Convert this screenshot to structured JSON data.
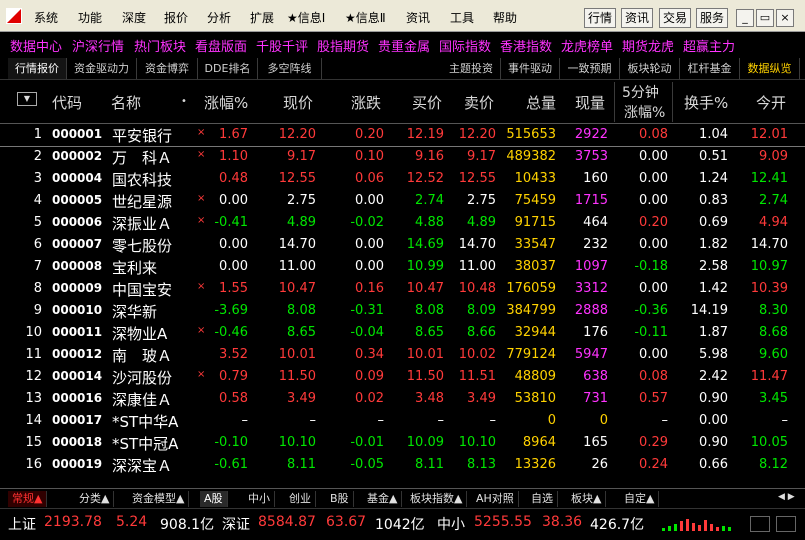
{
  "menu": [
    "系统",
    "功能",
    "深度",
    "报价",
    "分析",
    "扩展",
    "★信息Ⅰ",
    "★信息Ⅱ",
    "资讯",
    "工具",
    "帮助"
  ],
  "toolbar_buttons": [
    "行情",
    "资讯",
    "交易",
    "服务"
  ],
  "quicklinks": [
    "数据中心",
    "沪深行情",
    "热门板块",
    "看盘版面",
    "千股千评",
    "股指期货",
    "贵重金属",
    "国际指数",
    "香港指数",
    "龙虎榜单",
    "期货龙虎",
    "超赢主力"
  ],
  "tabs_left": [
    "行情报价",
    "资金驱动力",
    "资金博弈",
    "DDE排名",
    "多空阵线"
  ],
  "tabs_right": [
    "主题投资",
    "事件驱动",
    "一致预期",
    "板块轮动",
    "杠杆基金",
    "数据纵览"
  ],
  "columns": {
    "menu_toggle": "▼",
    "code": "代码",
    "name": "名称",
    "dot": "•",
    "pct_change": "涨幅%",
    "price": "现价",
    "change": "涨跌",
    "bid": "买价",
    "ask": "卖价",
    "volume": "总量",
    "cur_vol": "现量",
    "five_min_top": "5分钟",
    "five_min_bottom": "涨幅%",
    "turnover": "换手%",
    "open": "今开"
  },
  "rows": [
    {
      "i": "1",
      "code": "000001",
      "name": "平安银行",
      "mark": "×",
      "pct": "1.67",
      "price": "12.20",
      "chg": "0.20",
      "bid": "12.19",
      "ask": "12.20",
      "vol": "515653",
      "cur": "2922",
      "m5": "0.08",
      "turn": "1.04",
      "open": "12.01",
      "c": {
        "pct": "red",
        "price": "red",
        "chg": "red",
        "bid": "red",
        "ask": "red",
        "cur": "magenta",
        "m5": "red",
        "open": "red"
      }
    },
    {
      "i": "2",
      "code": "000002",
      "name": "万　科Ａ",
      "mark": "×",
      "pct": "1.10",
      "price": "9.17",
      "chg": "0.10",
      "bid": "9.16",
      "ask": "9.17",
      "vol": "489382",
      "cur": "3753",
      "m5": "0.00",
      "turn": "0.51",
      "open": "9.09",
      "c": {
        "pct": "red",
        "price": "red",
        "chg": "red",
        "bid": "red",
        "ask": "red",
        "cur": "magenta",
        "m5": "white",
        "open": "red"
      }
    },
    {
      "i": "3",
      "code": "000004",
      "name": "国农科技",
      "mark": "",
      "pct": "0.48",
      "price": "12.55",
      "chg": "0.06",
      "bid": "12.52",
      "ask": "12.55",
      "vol": "10433",
      "cur": "160",
      "m5": "0.00",
      "turn": "1.24",
      "open": "12.41",
      "c": {
        "pct": "red",
        "price": "red",
        "chg": "red",
        "bid": "red",
        "ask": "red",
        "cur": "white",
        "m5": "white",
        "open": "green"
      }
    },
    {
      "i": "4",
      "code": "000005",
      "name": "世纪星源",
      "mark": "×",
      "pct": "0.00",
      "price": "2.75",
      "chg": "0.00",
      "bid": "2.74",
      "ask": "2.75",
      "vol": "75459",
      "cur": "1715",
      "m5": "0.00",
      "turn": "0.83",
      "open": "2.74",
      "c": {
        "pct": "white",
        "price": "white",
        "chg": "white",
        "bid": "green",
        "ask": "white",
        "cur": "magenta",
        "m5": "white",
        "open": "green"
      }
    },
    {
      "i": "5",
      "code": "000006",
      "name": "深振业Ａ",
      "mark": "×",
      "pct": "-0.41",
      "price": "4.89",
      "chg": "-0.02",
      "bid": "4.88",
      "ask": "4.89",
      "vol": "91715",
      "cur": "464",
      "m5": "0.20",
      "turn": "0.69",
      "open": "4.94",
      "c": {
        "pct": "green",
        "price": "green",
        "chg": "green",
        "bid": "green",
        "ask": "green",
        "cur": "white",
        "m5": "red",
        "open": "red"
      }
    },
    {
      "i": "6",
      "code": "000007",
      "name": "零七股份",
      "mark": "",
      "pct": "0.00",
      "price": "14.70",
      "chg": "0.00",
      "bid": "14.69",
      "ask": "14.70",
      "vol": "33547",
      "cur": "232",
      "m5": "0.00",
      "turn": "1.82",
      "open": "14.70",
      "c": {
        "pct": "white",
        "price": "white",
        "chg": "white",
        "bid": "green",
        "ask": "white",
        "cur": "white",
        "m5": "white",
        "open": "white"
      }
    },
    {
      "i": "7",
      "code": "000008",
      "name": "宝利来",
      "mark": "",
      "pct": "0.00",
      "price": "11.00",
      "chg": "0.00",
      "bid": "10.99",
      "ask": "11.00",
      "vol": "38037",
      "cur": "1097",
      "m5": "-0.18",
      "turn": "2.58",
      "open": "10.97",
      "c": {
        "pct": "white",
        "price": "white",
        "chg": "white",
        "bid": "green",
        "ask": "white",
        "cur": "magenta",
        "m5": "green",
        "open": "green"
      }
    },
    {
      "i": "8",
      "code": "000009",
      "name": "中国宝安",
      "mark": "×",
      "pct": "1.55",
      "price": "10.47",
      "chg": "0.16",
      "bid": "10.47",
      "ask": "10.48",
      "vol": "176059",
      "cur": "3312",
      "m5": "0.00",
      "turn": "1.42",
      "open": "10.39",
      "c": {
        "pct": "red",
        "price": "red",
        "chg": "red",
        "bid": "red",
        "ask": "red",
        "cur": "magenta",
        "m5": "white",
        "open": "red"
      }
    },
    {
      "i": "9",
      "code": "000010",
      "name": "深华新",
      "mark": "",
      "pct": "-3.69",
      "price": "8.08",
      "chg": "-0.31",
      "bid": "8.08",
      "ask": "8.09",
      "vol": "384799",
      "cur": "2888",
      "m5": "-0.36",
      "turn": "14.19",
      "open": "8.30",
      "c": {
        "pct": "green",
        "price": "green",
        "chg": "green",
        "bid": "green",
        "ask": "green",
        "cur": "magenta",
        "m5": "green",
        "open": "green"
      }
    },
    {
      "i": "10",
      "code": "000011",
      "name": "深物业A",
      "mark": "×",
      "pct": "-0.46",
      "price": "8.65",
      "chg": "-0.04",
      "bid": "8.65",
      "ask": "8.66",
      "vol": "32944",
      "cur": "176",
      "m5": "-0.11",
      "turn": "1.87",
      "open": "8.68",
      "c": {
        "pct": "green",
        "price": "green",
        "chg": "green",
        "bid": "green",
        "ask": "green",
        "cur": "white",
        "m5": "green",
        "open": "green"
      }
    },
    {
      "i": "11",
      "code": "000012",
      "name": "南　玻Ａ",
      "mark": "",
      "pct": "3.52",
      "price": "10.01",
      "chg": "0.34",
      "bid": "10.01",
      "ask": "10.02",
      "vol": "779124",
      "cur": "5947",
      "m5": "0.00",
      "turn": "5.98",
      "open": "9.60",
      "c": {
        "pct": "red",
        "price": "red",
        "chg": "red",
        "bid": "red",
        "ask": "red",
        "cur": "magenta",
        "m5": "white",
        "open": "green"
      }
    },
    {
      "i": "12",
      "code": "000014",
      "name": "沙河股份",
      "mark": "×",
      "pct": "0.79",
      "price": "11.50",
      "chg": "0.09",
      "bid": "11.50",
      "ask": "11.51",
      "vol": "48809",
      "cur": "638",
      "m5": "0.08",
      "turn": "2.42",
      "open": "11.47",
      "c": {
        "pct": "red",
        "price": "red",
        "chg": "red",
        "bid": "red",
        "ask": "red",
        "cur": "magenta",
        "m5": "red",
        "open": "red"
      }
    },
    {
      "i": "13",
      "code": "000016",
      "name": "深康佳Ａ",
      "mark": "",
      "pct": "0.58",
      "price": "3.49",
      "chg": "0.02",
      "bid": "3.48",
      "ask": "3.49",
      "vol": "53810",
      "cur": "731",
      "m5": "0.57",
      "turn": "0.90",
      "open": "3.45",
      "c": {
        "pct": "red",
        "price": "red",
        "chg": "red",
        "bid": "red",
        "ask": "red",
        "cur": "magenta",
        "m5": "red",
        "open": "green"
      }
    },
    {
      "i": "14",
      "code": "000017",
      "name": "*ST中华A",
      "mark": "",
      "pct": "–",
      "price": "–",
      "chg": "–",
      "bid": "–",
      "ask": "–",
      "vol": "0",
      "cur": "0",
      "m5": "–",
      "turn": "0.00",
      "open": "–",
      "c": {
        "pct": "white",
        "price": "white",
        "chg": "white",
        "bid": "white",
        "ask": "white",
        "cur": "yellow",
        "m5": "white",
        "open": "white"
      }
    },
    {
      "i": "15",
      "code": "000018",
      "name": "*ST中冠A",
      "mark": "",
      "pct": "-0.10",
      "price": "10.10",
      "chg": "-0.01",
      "bid": "10.09",
      "ask": "10.10",
      "vol": "8964",
      "cur": "165",
      "m5": "0.29",
      "turn": "0.90",
      "open": "10.05",
      "c": {
        "pct": "green",
        "price": "green",
        "chg": "green",
        "bid": "green",
        "ask": "green",
        "cur": "white",
        "m5": "red",
        "open": "green"
      }
    },
    {
      "i": "16",
      "code": "000019",
      "name": "深深宝Ａ",
      "mark": "",
      "pct": "-0.61",
      "price": "8.11",
      "chg": "-0.05",
      "bid": "8.11",
      "ask": "8.13",
      "vol": "13326",
      "cur": "26",
      "m5": "0.24",
      "turn": "0.66",
      "open": "8.12",
      "c": {
        "pct": "green",
        "price": "green",
        "chg": "green",
        "bid": "green",
        "ask": "green",
        "cur": "white",
        "m5": "red",
        "open": "green"
      }
    }
  ],
  "bottom_tabs": [
    "常规▲",
    "分类▲",
    "资金模型▲",
    "A股",
    "中小",
    "创业",
    "B股",
    "基金▲",
    "板块指数▲",
    "AH对照",
    "自选",
    "板块▲",
    "自定▲"
  ],
  "bottom_tab_arrows": "◀ ▶",
  "index_bar": {
    "sh_label": "上证",
    "sh_value": "2193.78",
    "sh_chg": "5.24",
    "sh_amt": "908.1亿",
    "sz_label": "深证",
    "sz_value": "8584.87",
    "sz_chg": "63.67",
    "sz_amt": "1042亿",
    "zx_label": "中小",
    "zx_value": "5255.55",
    "zx_chg": "38.36",
    "zx_amt": "426.7亿"
  },
  "vol_bars": [
    {
      "color": "#00e600",
      "level": 0.25
    },
    {
      "color": "#00e600",
      "level": 0.4
    },
    {
      "color": "#00e600",
      "level": 0.6
    },
    {
      "color": "#ff3a3a",
      "level": 0.8
    },
    {
      "color": "#ff3a3a",
      "level": 1.0
    },
    {
      "color": "#ff3a3a",
      "level": 0.7
    },
    {
      "color": "#ff3a3a",
      "level": 0.5
    },
    {
      "color": "#ff3a3a",
      "level": 0.9
    },
    {
      "color": "#ff3a3a",
      "level": 0.6
    },
    {
      "color": "#ff3a3a",
      "level": 0.3
    },
    {
      "color": "#00e600",
      "level": 0.45
    },
    {
      "color": "#00e600",
      "level": 0.3
    }
  ]
}
